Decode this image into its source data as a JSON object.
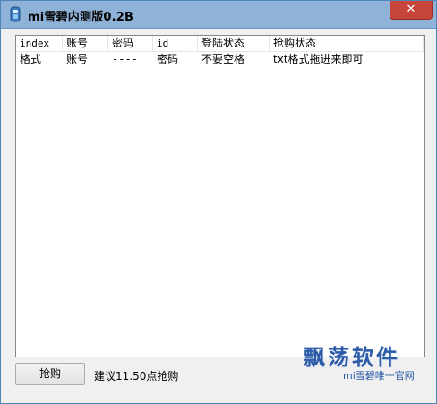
{
  "window": {
    "title": "mi雪碧内测版0.2B",
    "close_label": "✕"
  },
  "table": {
    "columns": [
      "index",
      "账号",
      "密码",
      "id",
      "登陆状态",
      "抢购状态"
    ],
    "rows": [
      [
        "格式",
        "账号",
        "----",
        "密码",
        "不要空格",
        "txt格式拖进来即可"
      ]
    ]
  },
  "footer": {
    "button_label": "抢购",
    "hint": "建议11.50点抢购"
  },
  "watermark": {
    "logo": "飘荡软件",
    "sub": "mi雪碧唯一官网"
  },
  "colors": {
    "titlebar": "#8fb2d8",
    "close_button": "#c7443a",
    "watermark": "#2b5aa7"
  }
}
